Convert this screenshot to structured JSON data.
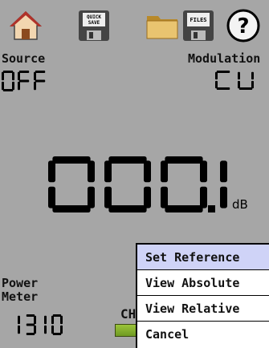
{
  "toolbar": {
    "buttons": [
      {
        "name": "home",
        "icon": "house-icon"
      },
      {
        "name": "quick-save",
        "icon": "floppy-icon",
        "text": "QUICK SAVE"
      },
      {
        "name": "folder",
        "icon": "folder-icon"
      },
      {
        "name": "files",
        "icon": "floppy-icon",
        "text": "FILES"
      },
      {
        "name": "help",
        "icon": "question-icon",
        "text": "?"
      }
    ]
  },
  "source": {
    "label": "Source",
    "value": "OFF"
  },
  "modulation": {
    "label": "Modulation",
    "value": "CW"
  },
  "main_reading": {
    "value": "000.1",
    "unit": "dB"
  },
  "power_meter": {
    "label_line1": "Power",
    "label_line2": "Meter",
    "value": "1310"
  },
  "channel": {
    "label": "CH",
    "bar_level": 1.0
  },
  "context_menu": {
    "items": [
      {
        "label": "Set Reference",
        "selected": true
      },
      {
        "label": "View Absolute",
        "selected": false
      },
      {
        "label": "View Relative",
        "selected": false
      },
      {
        "label": "Cancel",
        "selected": false
      }
    ]
  },
  "colors": {
    "background": "#a6a6a6",
    "menu_selected": "#cfd3f7",
    "segment": "#000000"
  }
}
